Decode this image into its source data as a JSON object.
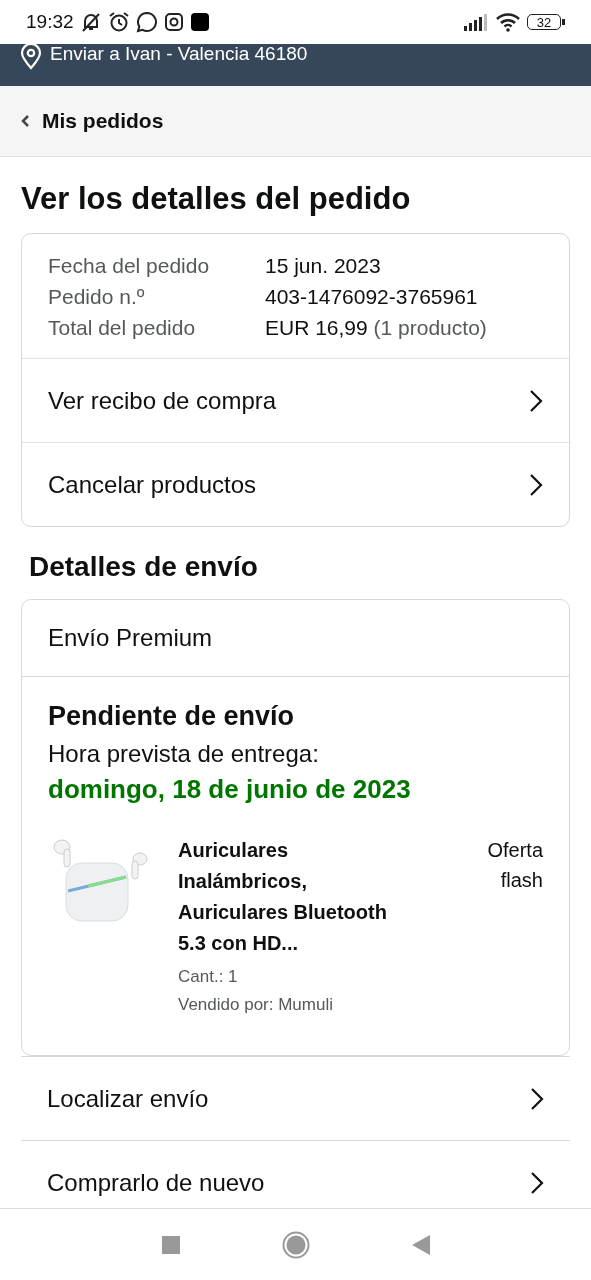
{
  "status_bar": {
    "time": "19:32",
    "battery": "32"
  },
  "location_bar": {
    "text": "Enviar a Ivan - Valencia 46180"
  },
  "breadcrumb": {
    "label": "Mis pedidos"
  },
  "title": "Ver los detalles del pedido",
  "order_summary": {
    "fields": [
      {
        "label": "Fecha del pedido",
        "value": "15 jun. 2023"
      },
      {
        "label": "Pedido n.º",
        "value": "403-1476092-3765961"
      },
      {
        "label": "Total del pedido",
        "value": "EUR 16,99",
        "note": "(1 producto)"
      }
    ],
    "actions": [
      "Ver recibo de compra",
      "Cancelar productos"
    ]
  },
  "shipping": {
    "heading": "Detalles de envío",
    "service": "Envío Premium",
    "status": "Pendiente de envío",
    "eta_label": "Hora prevista de entrega:",
    "eta_date": "domingo, 18 de junio de 2023",
    "item": {
      "title": "Auriculares Inalámbricos, Auriculares Bluetooth 5.3 con HD...",
      "quantity": "Cant.: 1",
      "seller": "Vendido por: Mumuli",
      "badge": "Oferta flash"
    }
  },
  "actions": [
    "Localizar envío",
    "Comprarlo de nuevo"
  ]
}
